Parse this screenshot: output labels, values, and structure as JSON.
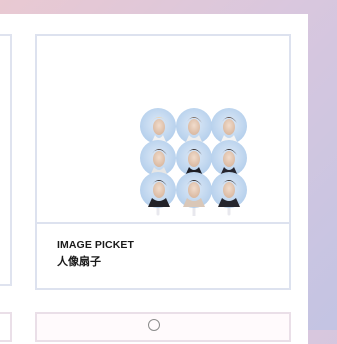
{
  "product": {
    "name": "IMAGE PICKET",
    "name_jp": "人像扇子"
  },
  "colors": {
    "fan_bg": "#b9d3ee",
    "fan_bg_light": "#d3e3f4",
    "card_border": "#dde2ef",
    "text": "#1a1a1a"
  },
  "icons": [
    "shopping-bag-icon"
  ]
}
